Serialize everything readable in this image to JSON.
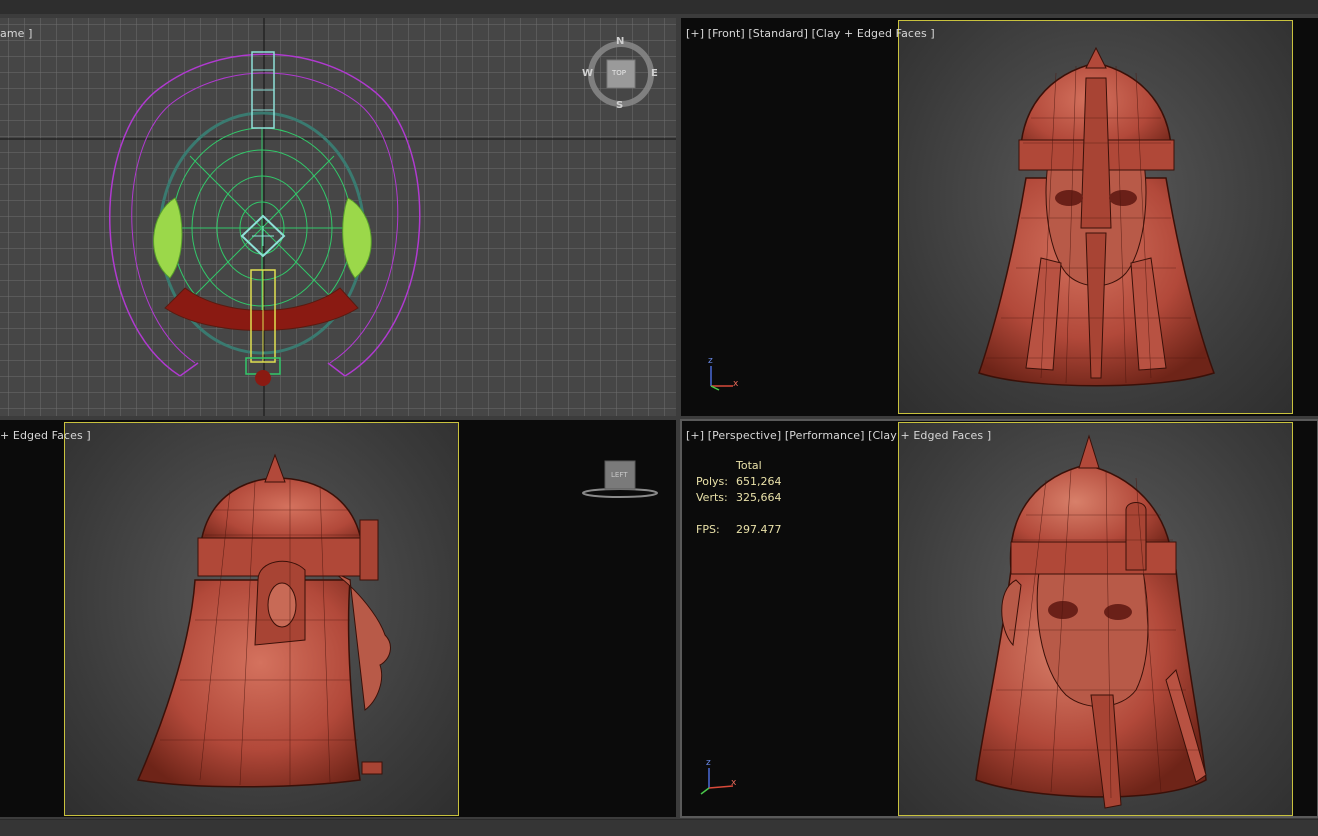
{
  "viewports": {
    "top": {
      "label": "ame ]",
      "compass": {
        "n": "N",
        "s": "S",
        "e": "E",
        "w": "W",
        "face": "TOP"
      }
    },
    "front": {
      "label": "[+] [Front] [Standard] [Clay + Edged Faces ]",
      "axis": {
        "z": "z",
        "x": "x"
      }
    },
    "left": {
      "label": "+ Edged Faces ]",
      "cube_face": "LEFT"
    },
    "perspective": {
      "label": "[+] [Perspective] [Performance] [Clay + Edged Faces ]",
      "stats": {
        "header": "Total",
        "polys_label": "Polys:",
        "polys": "651,264",
        "verts_label": "Verts:",
        "verts": "325,664",
        "fps_label": "FPS:",
        "fps": "297.477"
      },
      "axis": {
        "z": "z",
        "x": "x"
      }
    }
  },
  "colors": {
    "clay": "#b2493a",
    "clay_dark": "#7a2a20",
    "wire_purple": "#b03ad0",
    "wire_green": "#32c86a",
    "wire_yellow": "#e0e050",
    "frame_yellow": "#c9c23e",
    "stats_text": "#e8e0a8"
  }
}
